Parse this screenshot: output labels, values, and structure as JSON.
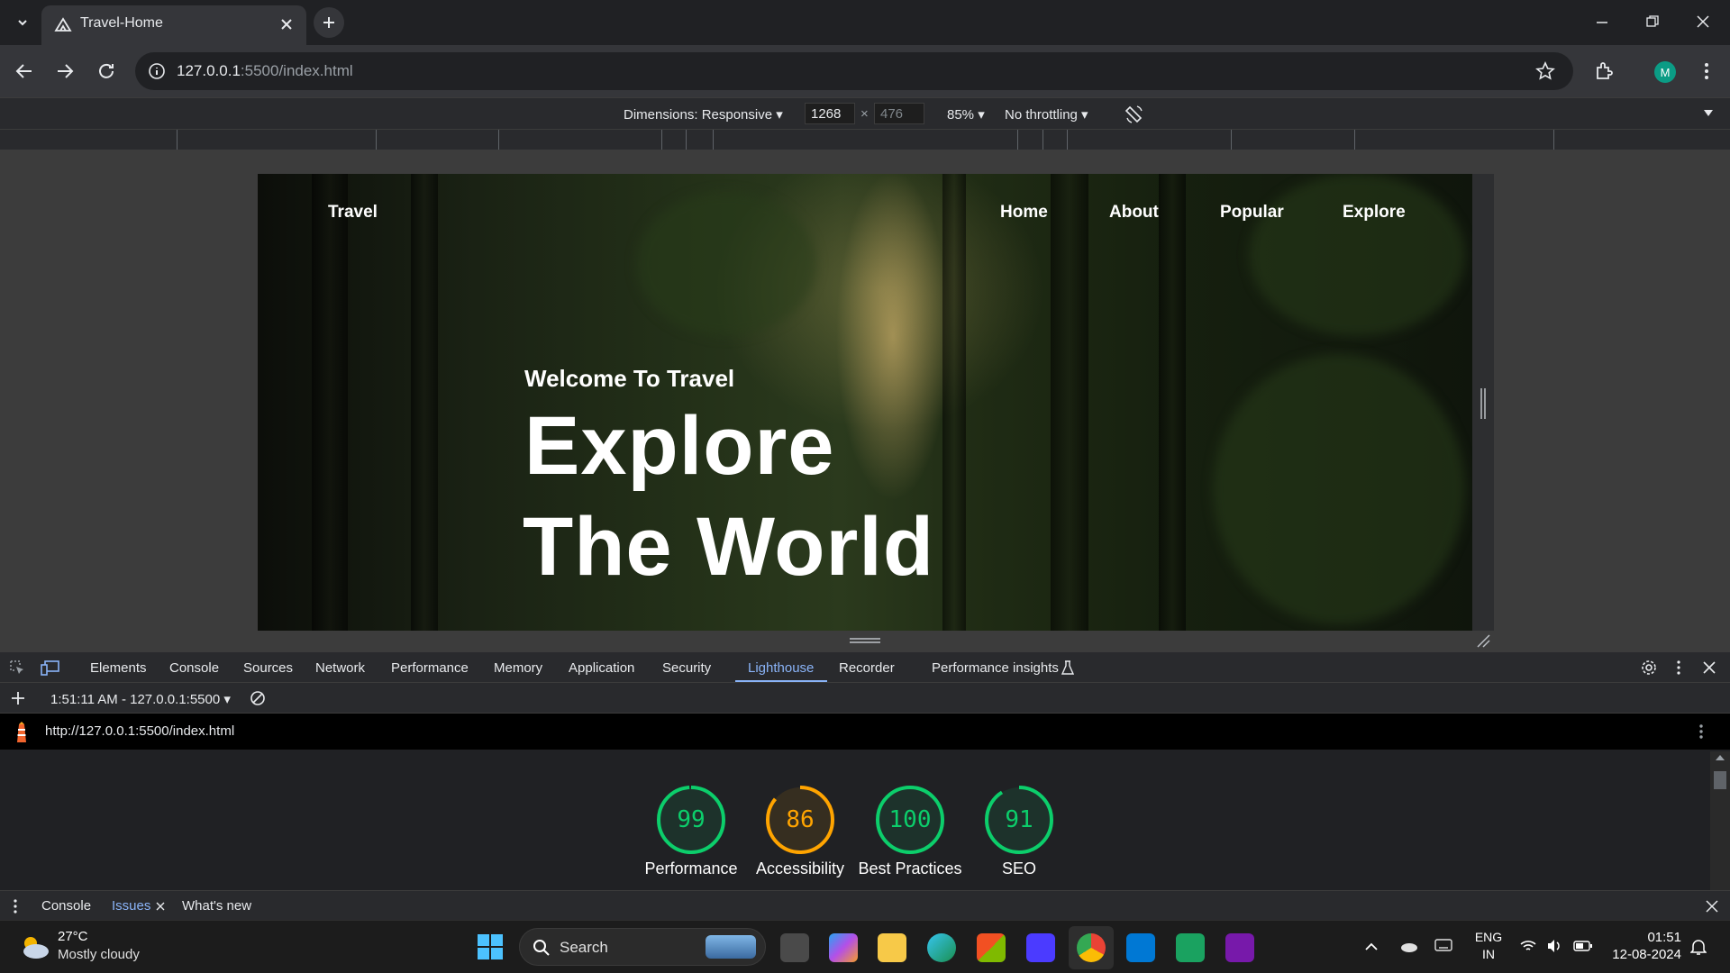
{
  "browser": {
    "tab_title": "Travel-Home",
    "url_host": "127.0.0.1",
    "url_rest": ":5500/index.html",
    "profile_initial": "M"
  },
  "device_toolbar": {
    "dimensions_label": "Dimensions: Responsive",
    "width_value": "1268",
    "times": "×",
    "height_placeholder": "476",
    "zoom": "85%",
    "throttling": "No throttling"
  },
  "site": {
    "brand": "Travel",
    "nav": [
      "Home",
      "About",
      "Popular",
      "Explore"
    ],
    "kicker": "Welcome To Travel",
    "headline_line1": "Explore",
    "headline_line2": "The World"
  },
  "devtools": {
    "tabs": [
      "Elements",
      "Console",
      "Sources",
      "Network",
      "Performance",
      "Memory",
      "Application",
      "Security",
      "Lighthouse",
      "Recorder",
      "Performance insights"
    ],
    "active_tab": "Lighthouse",
    "session_label": "1:51:11 AM - 127.0.0.1:5500",
    "report_url": "http://127.0.0.1:5500/index.html",
    "scores": [
      {
        "value": "99",
        "label": "Performance",
        "score": 0.99,
        "color": "#0cce6b"
      },
      {
        "value": "86",
        "label": "Accessibility",
        "score": 0.86,
        "color": "#ffa400"
      },
      {
        "value": "100",
        "label": "Best Practices",
        "score": 1.0,
        "color": "#0cce6b"
      },
      {
        "value": "91",
        "label": "SEO",
        "score": 0.91,
        "color": "#0cce6b"
      }
    ],
    "drawer_tabs": [
      "Console",
      "Issues",
      "What's new"
    ],
    "drawer_active": "Issues"
  },
  "taskbar": {
    "weather_temp": "27°C",
    "weather_desc": "Mostly cloudy",
    "search_label": "Search",
    "lang_line1": "ENG",
    "lang_line2": "IN",
    "time": "01:51",
    "date": "12-08-2024"
  },
  "colors": {
    "accent_blue": "#8ab4f8",
    "pass_green": "#0cce6b",
    "average_orange": "#ffa400"
  }
}
